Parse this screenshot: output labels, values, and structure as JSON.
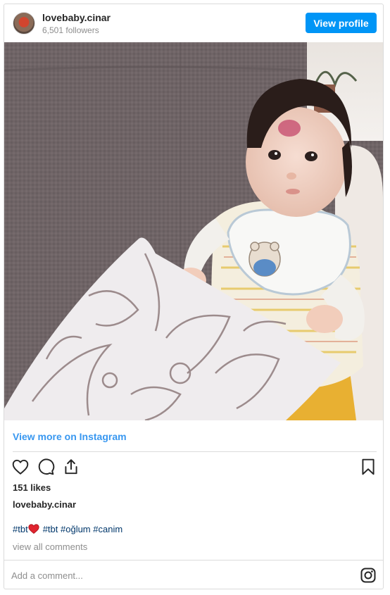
{
  "header": {
    "username": "lovebaby.cinar",
    "followers": "6,501 followers",
    "view_profile_label": "View profile"
  },
  "post": {
    "view_more_label": "View more on Instagram",
    "likes": "151 likes",
    "caption_username": "lovebaby.cinar",
    "hashtags": [
      "#tbt",
      "#tbt",
      "#oğlum",
      "#canim"
    ],
    "view_comments_label": "view all comments",
    "comment_placeholder": "Add a comment..."
  },
  "icons": {
    "like": "heart-outline-icon",
    "comment": "comment-bubble-icon",
    "share": "share-icon",
    "save": "bookmark-icon",
    "brand": "instagram-logo-icon",
    "emoji": "red-heart-emoji"
  },
  "colors": {
    "accent": "#0095f6",
    "link": "#3897f0",
    "hashtag": "#00376b",
    "muted": "#8e8e8e",
    "border": "#dbdbdb"
  }
}
